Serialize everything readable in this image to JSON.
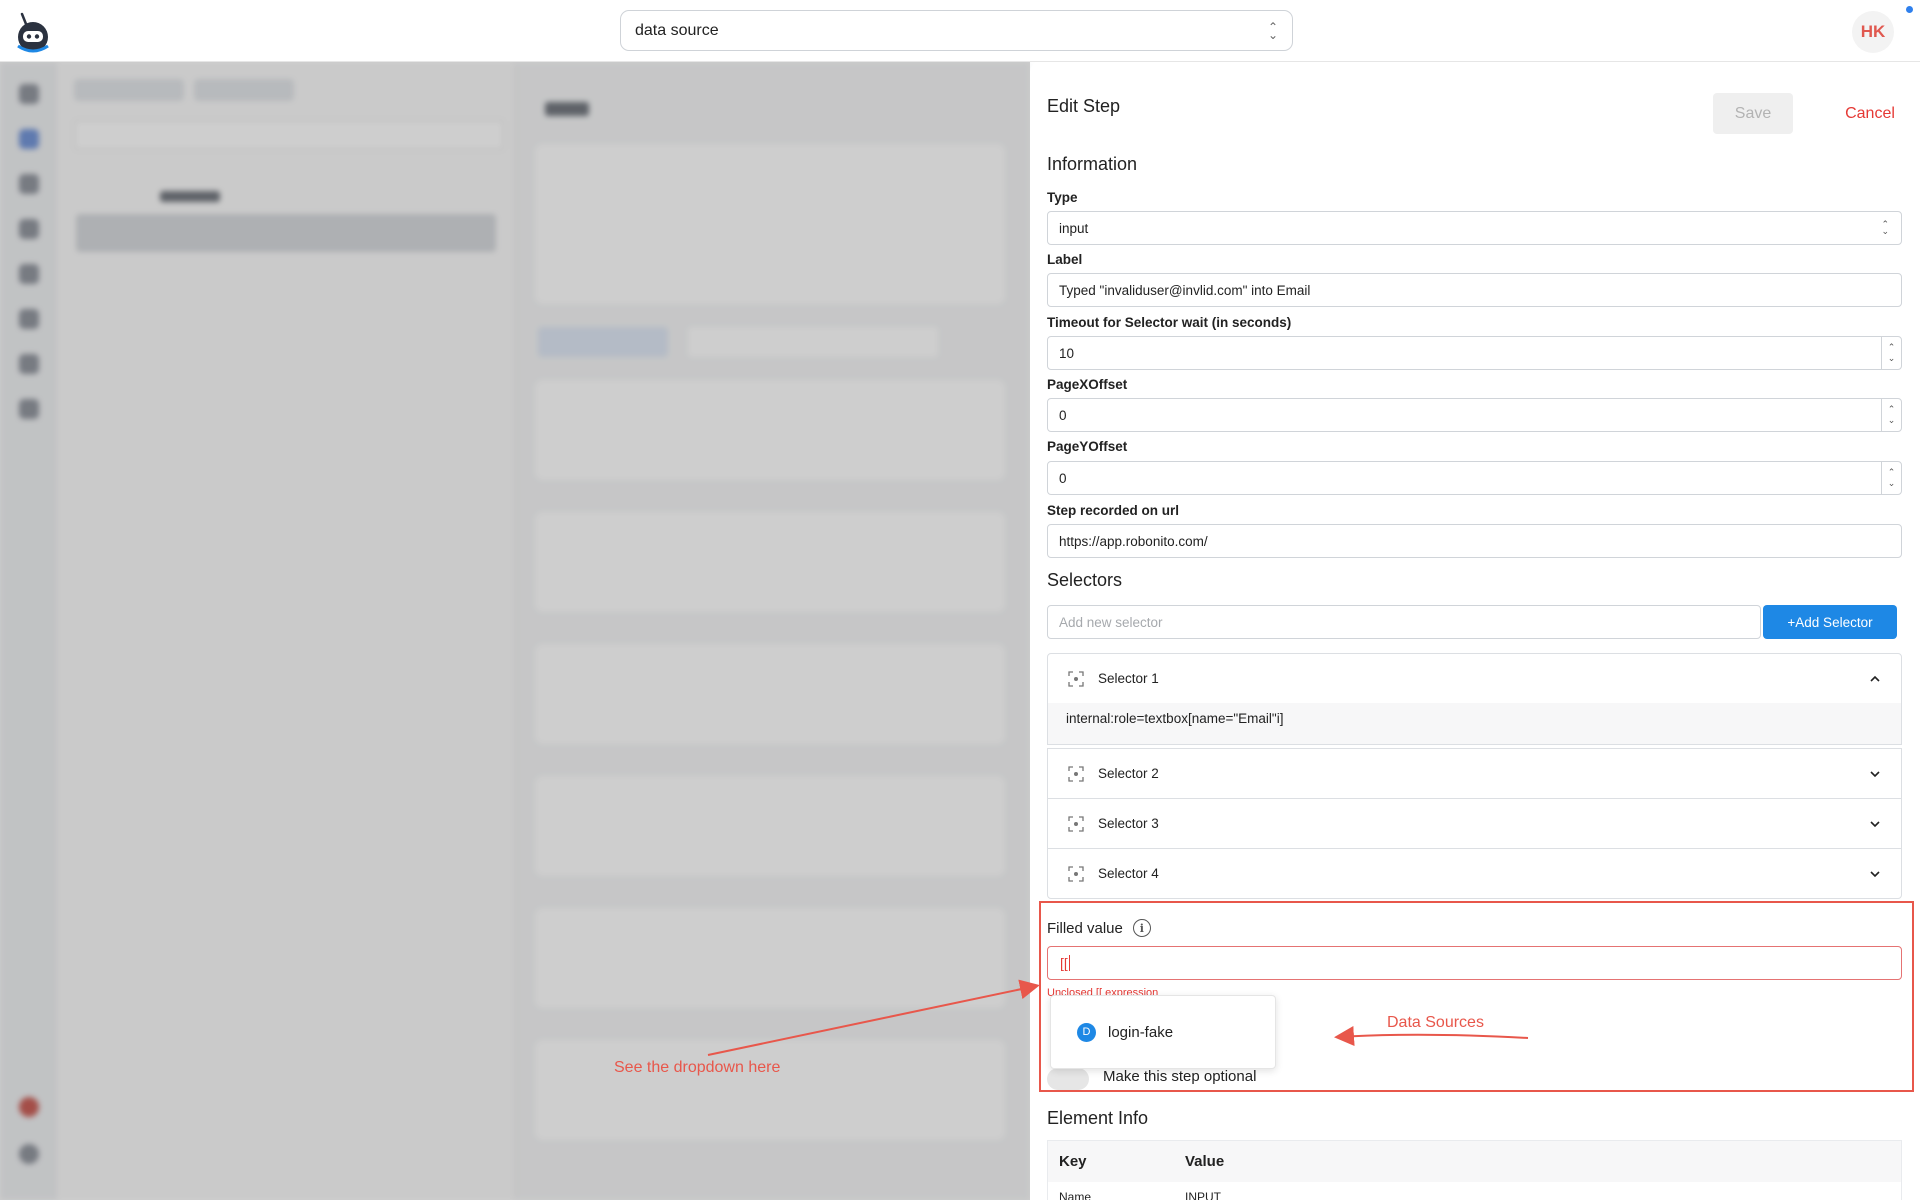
{
  "topbar": {
    "search_value": "data source",
    "avatar_initials": "HK"
  },
  "panel": {
    "title": "Edit Step",
    "save_label": "Save",
    "cancel_label": "Cancel",
    "information_heading": "Information",
    "type": {
      "label": "Type",
      "value": "input"
    },
    "label_field": {
      "label": "Label",
      "value": "Typed \"invaliduser@invlid.com\" into Email"
    },
    "timeout": {
      "label": "Timeout for Selector wait (in seconds)",
      "value": "10"
    },
    "page_x": {
      "label": "PageXOffset",
      "value": "0"
    },
    "page_y": {
      "label": "PageYOffset",
      "value": "0"
    },
    "url": {
      "label": "Step recorded on url",
      "value": "https://app.robonito.com/"
    },
    "selectors_heading": "Selectors",
    "selector_placeholder": "Add new selector",
    "add_selector_label": "+Add Selector",
    "selectors": [
      {
        "name": "Selector 1",
        "value": "internal:role=textbox[name=\"Email\"i]",
        "expanded": true
      },
      {
        "name": "Selector 2",
        "expanded": false
      },
      {
        "name": "Selector 3",
        "expanded": false
      },
      {
        "name": "Selector 4",
        "expanded": false
      }
    ],
    "filled_value": {
      "label": "Filled value",
      "value": "[[",
      "error": "Unclosed [[ expression"
    },
    "dropdown": {
      "badge": "D",
      "item": "login-fake"
    },
    "optional_label": "Make this step optional",
    "element_info": {
      "heading": "Element Info",
      "columns": [
        "Key",
        "Value"
      ],
      "rows": [
        {
          "key": "Name",
          "value": "INPUT"
        }
      ]
    }
  },
  "annotations": {
    "dropdown_note": "See the dropdown here",
    "data_sources_note": "Data Sources",
    "color": "#e8574b"
  }
}
